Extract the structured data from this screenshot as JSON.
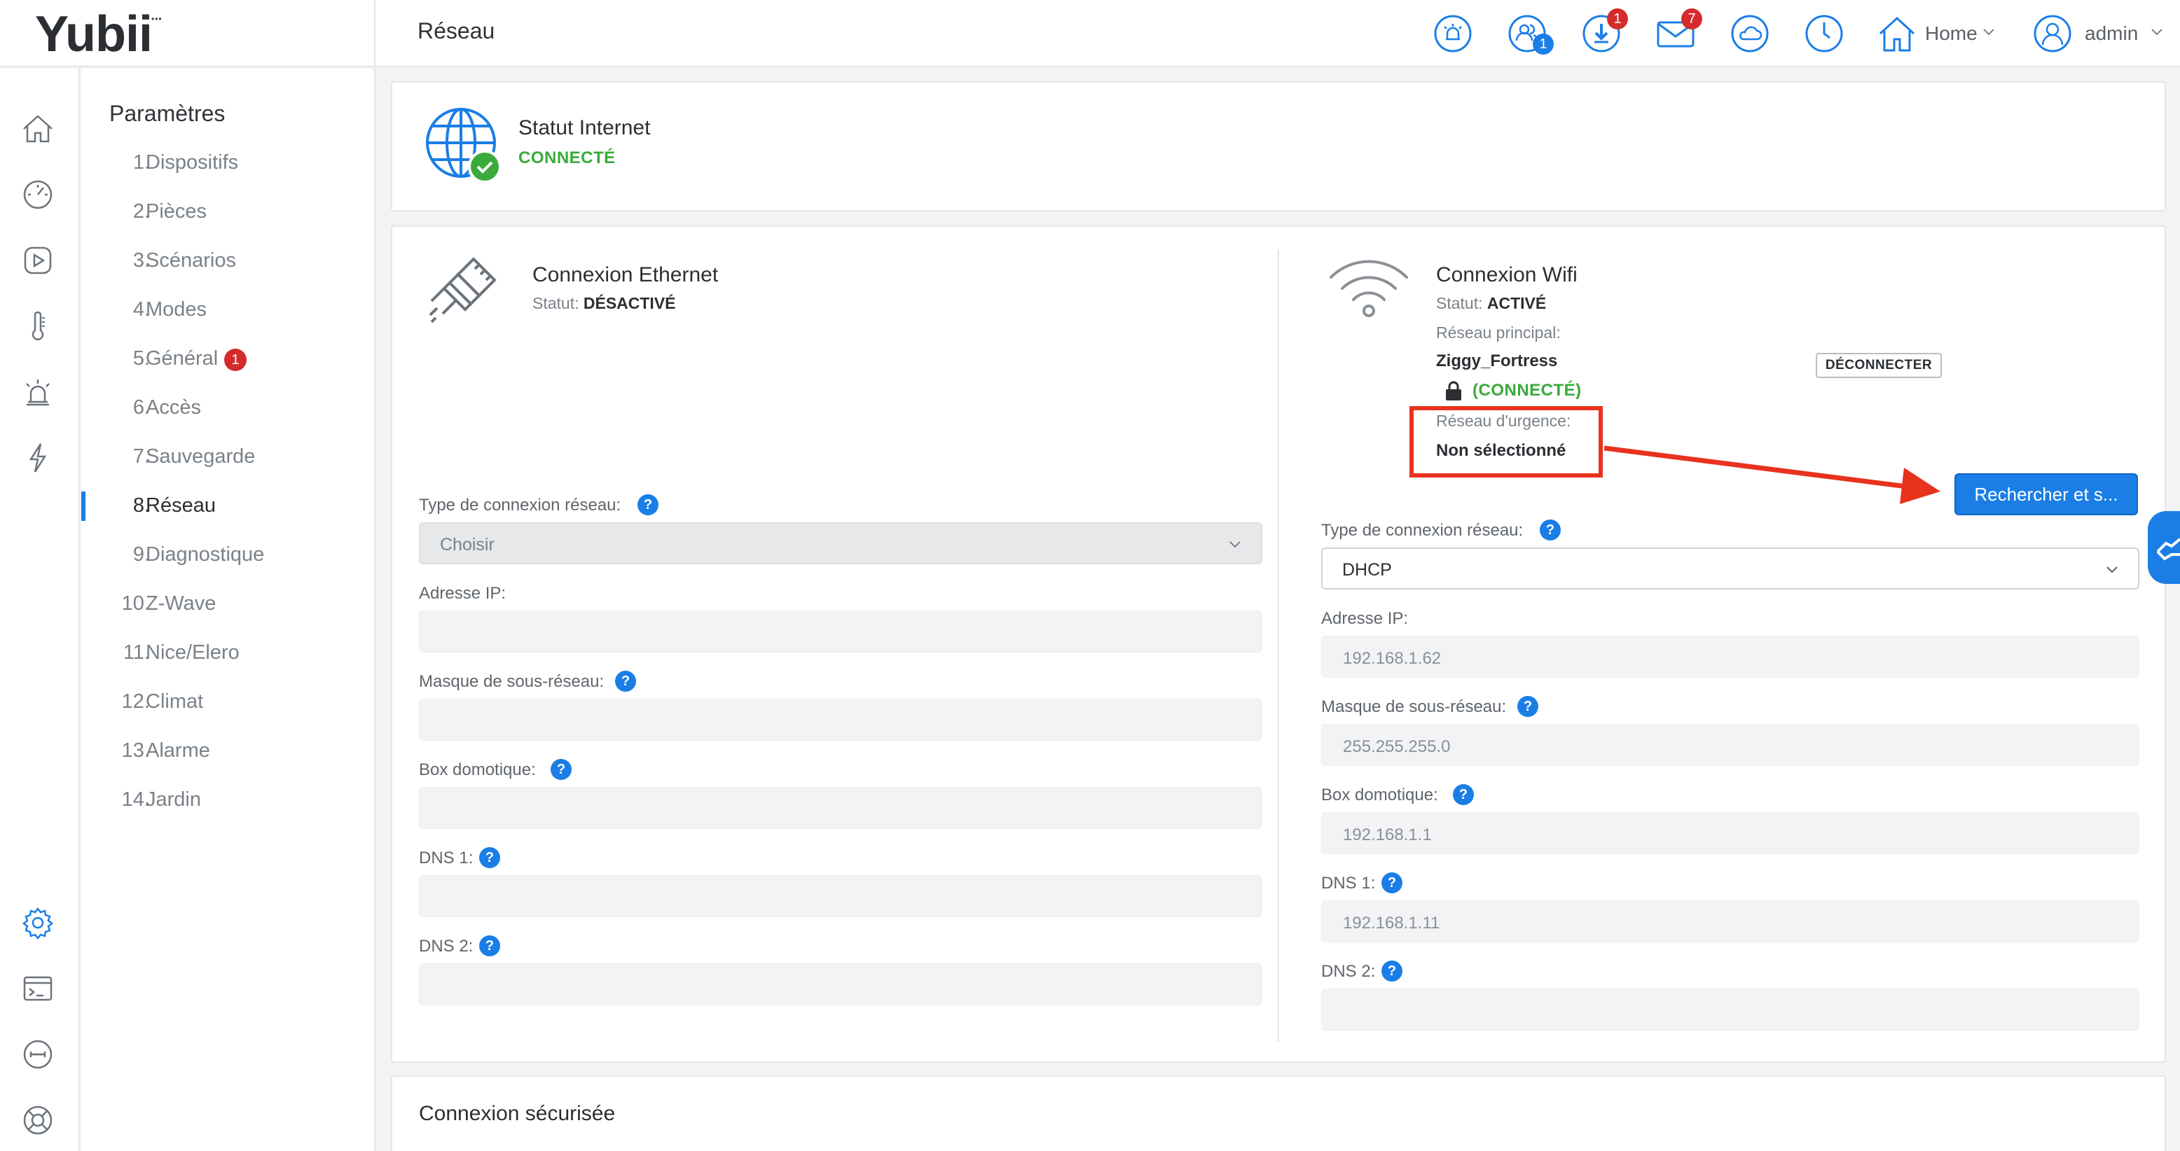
{
  "app": {
    "logo": "Yubii",
    "page_title": "Réseau"
  },
  "topbar": {
    "people_badge": "1",
    "download_badge": "1",
    "mail_badge": "7",
    "home_label": "Home",
    "user_label": "admin",
    "icons": [
      "alarm-icon",
      "users-icon",
      "download-icon",
      "mail-icon",
      "weather-icon",
      "clock-icon",
      "home-icon",
      "user-icon"
    ]
  },
  "rail": {
    "icons": [
      "home-icon",
      "dashboard-icon",
      "play-icon",
      "thermometer-icon",
      "alarm-icon",
      "lightning-icon",
      "gear-icon",
      "terminal-icon",
      "network-icon",
      "lifebuoy-icon"
    ]
  },
  "menu": {
    "title": "Paramètres",
    "items": [
      {
        "num": "1.",
        "label": "Dispositifs"
      },
      {
        "num": "2.",
        "label": "Pièces"
      },
      {
        "num": "3.",
        "label": "Scénarios"
      },
      {
        "num": "4.",
        "label": "Modes"
      },
      {
        "num": "5.",
        "label": "Général",
        "badge": "1"
      },
      {
        "num": "6.",
        "label": "Accès"
      },
      {
        "num": "7.",
        "label": "Sauvegarde"
      },
      {
        "num": "8.",
        "label": "Réseau",
        "active": true
      },
      {
        "num": "9.",
        "label": "Diagnostique"
      },
      {
        "num": "10.",
        "label": "Z-Wave"
      },
      {
        "num": "11.",
        "label": "Nice/Elero"
      },
      {
        "num": "12.",
        "label": "Climat"
      },
      {
        "num": "13.",
        "label": "Alarme"
      },
      {
        "num": "14.",
        "label": "Jardin"
      }
    ]
  },
  "internet": {
    "title": "Statut Internet",
    "status": "CONNECTÉ"
  },
  "ethernet": {
    "title": "Connexion Ethernet",
    "status_label": "Statut:",
    "status_value": "DÉSACTIVÉ",
    "conn_type_label": "Type de connexion réseau:",
    "conn_type_value": "Choisir",
    "ip_label": "Adresse IP:",
    "mask_label": "Masque de sous-réseau:",
    "box_label": "Box domotique:",
    "dns1_label": "DNS 1:",
    "dns2_label": "DNS 2:"
  },
  "wifi": {
    "title": "Connexion Wifi",
    "status_label": "Statut:",
    "status_value": "ACTIVÉ",
    "main_network_label": "Réseau principal:",
    "main_network_value": "Ziggy_Fortress",
    "main_network_state": "(CONNECTÉ)",
    "disconnect_label": "DÉCONNECTER",
    "emergency_label": "Réseau d'urgence:",
    "emergency_value": "Non sélectionné",
    "search_label": "Rechercher et s...",
    "conn_type_label": "Type de connexion réseau:",
    "conn_type_value": "DHCP",
    "ip_label": "Adresse IP:",
    "ip_value": "192.168.1.62",
    "mask_label": "Masque de sous-réseau:",
    "mask_value": "255.255.255.0",
    "box_label": "Box domotique:",
    "box_value": "192.168.1.1",
    "dns1_label": "DNS 1:",
    "dns1_value": "192.168.1.11",
    "dns2_label": "DNS 2:"
  },
  "secure": {
    "title": "Connexion sécurisée"
  },
  "help": {
    "mark": "?"
  },
  "colors": {
    "accent": "#1a7ee6",
    "ok": "#3aaa3a",
    "badge": "#d42c2c",
    "annotation": "#e8321e"
  }
}
